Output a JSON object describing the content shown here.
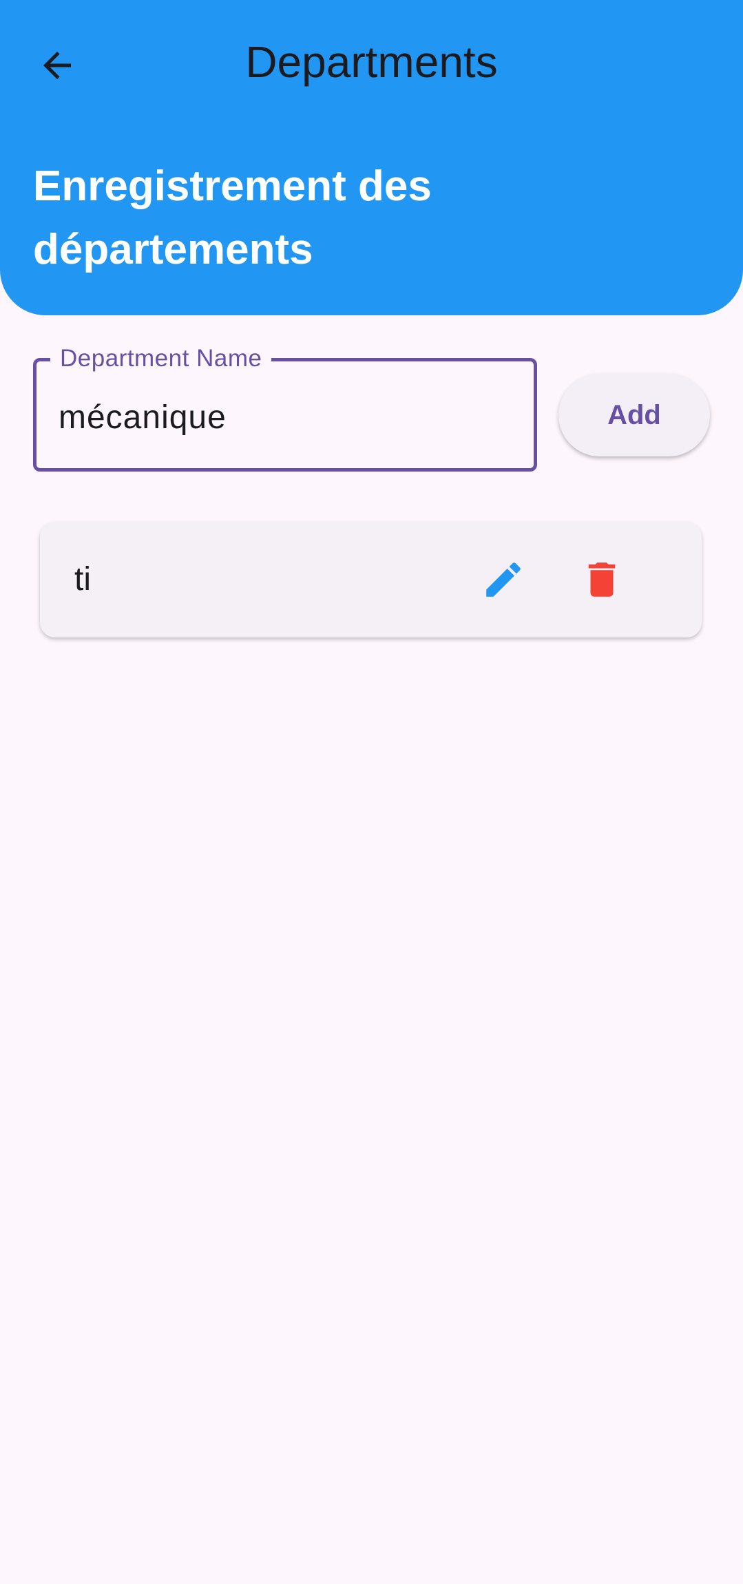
{
  "app_bar": {
    "title": "Departments",
    "back_icon": "arrow-back-icon"
  },
  "header": {
    "heading": "Enregistrement des départements",
    "background_color": "#2196f3"
  },
  "form": {
    "field_label": "Department Name",
    "field_value": "mécanique",
    "add_label": "Add",
    "accent_color": "#6750a4"
  },
  "departments": [
    {
      "name": "ti",
      "edit_icon": "pencil-icon",
      "delete_icon": "trash-icon",
      "edit_color": "#2196f3",
      "delete_color": "#f44336"
    }
  ]
}
